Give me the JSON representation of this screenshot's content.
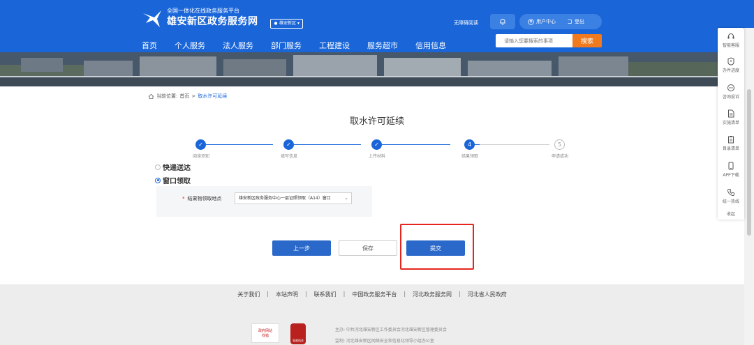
{
  "header": {
    "logo_subtitle": "全国一体化在线政务服务平台",
    "logo_title": "雄安新区政务服务网",
    "region": "雄安新区",
    "accessibility_link": "无障碍阅读",
    "user_center": "用户中心",
    "logout": "登出",
    "nav": [
      "首页",
      "个人服务",
      "法人服务",
      "部门服务",
      "工程建设",
      "服务超市",
      "信用信息"
    ],
    "search_placeholder": "请输入您要搜索的事项",
    "search_button": "搜索"
  },
  "sidebar": {
    "items": [
      "智能客服",
      "办件进度",
      "咨询投诉",
      "实施清单",
      "目录清单",
      "APP下载",
      "统一热线"
    ],
    "collapse": "收起"
  },
  "breadcrumb": {
    "prefix": "当前位置:",
    "home": "首页",
    "separator": ">",
    "current": "取水许可延续"
  },
  "page_title": "取水许可延续",
  "steps": [
    {
      "label": "阅读须知",
      "status": "done"
    },
    {
      "label": "填写信息",
      "status": "done"
    },
    {
      "label": "上传材料",
      "status": "done"
    },
    {
      "label": "结果领取",
      "status": "current",
      "number": "4"
    },
    {
      "label": "申请成功",
      "status": "pending",
      "number": "5"
    }
  ],
  "options": {
    "express": "快递送达",
    "window": "窗口领取",
    "selected": "窗口领取"
  },
  "pickup": {
    "required_mark": "*",
    "label": "结果物领取地点",
    "value": "雄安新区政务服务中心一层证照领取（A14）窗口"
  },
  "buttons": {
    "prev": "上一步",
    "save": "保存",
    "submit": "提交"
  },
  "footer": {
    "links": [
      "关于我们",
      "本站声明",
      "联系我们",
      "中国政务服务平台",
      "河北政务服务网",
      "河北省人民政府"
    ],
    "link_separator": "|",
    "logo1_line1": "政府网站",
    "logo1_line2": "找错",
    "logo2_text": "党政机关",
    "sponsor": "主办: 中共河北雄安新区工作委员会河北雄安新区管理委员会",
    "organizer": "监制: 河北雄安新区网络安全和信息化领导小组办公室"
  },
  "colors": {
    "primary": "#1a66d9",
    "button": "#2a68c9",
    "search_button": "#f07a1d",
    "highlight": "#e5261e"
  }
}
